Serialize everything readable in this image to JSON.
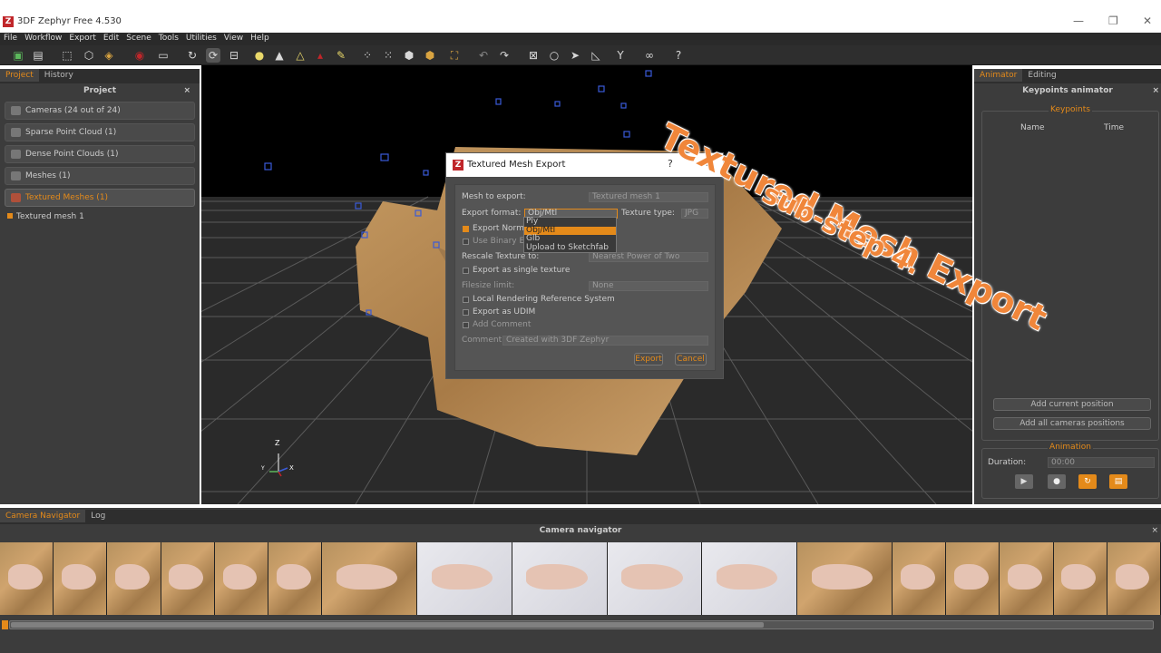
{
  "window": {
    "title": "3DF Zephyr Free 4.530",
    "logo": "Z",
    "minimize": "—",
    "maximize": "❐",
    "close": "✕"
  },
  "menu": [
    "File",
    "Workflow",
    "Export",
    "Edit",
    "Scene",
    "Tools",
    "Utilities",
    "View",
    "Help"
  ],
  "left_panel": {
    "tabs": [
      "Project",
      "History"
    ],
    "title": "Project",
    "close": "×",
    "items": [
      {
        "label": "Cameras (24 out of 24)",
        "icon": "camera-icon"
      },
      {
        "label": "Sparse Point Cloud (1)",
        "icon": "sparse-cloud-icon"
      },
      {
        "label": "Dense Point Clouds (1)",
        "icon": "dense-cloud-icon"
      },
      {
        "label": "Meshes (1)",
        "icon": "mesh-icon"
      },
      {
        "label": "Textured Meshes (1)",
        "icon": "textured-mesh-icon"
      }
    ],
    "tree_item": "Textured mesh 1"
  },
  "right_panel": {
    "tabs": [
      "Animator",
      "Editing"
    ],
    "title": "Keypoints animator",
    "close": "×",
    "keypoints_legend": "Keypoints",
    "columns": [
      "Name",
      "Time"
    ],
    "add_current": "Add current position",
    "add_all": "Add all cameras positions",
    "animation_legend": "Animation",
    "duration_label": "Duration:",
    "duration_value": "00:00"
  },
  "viewport": {
    "axis_z": "Z",
    "axis_y": "Y",
    "axis_x": "X"
  },
  "dialog": {
    "title": "Textured Mesh Export",
    "help": "?",
    "close": "✕",
    "mesh_label": "Mesh to export:",
    "mesh_value": "Textured mesh 1",
    "format_label": "Export format:",
    "format_value": "Obj/Mtl",
    "texture_type_label": "Texture type:",
    "texture_type_value": "JPG",
    "export_normals": "Export Normals",
    "use_binary": "Use Binary Encoding",
    "rescale_label": "Rescale Texture to:",
    "rescale_value": "Nearest Power of Two",
    "single_texture": "Export as single texture",
    "filesize_label": "Filesize limit:",
    "filesize_value": "None",
    "local_ref": "Local Rendering Reference System",
    "udim": "Export as UDIM",
    "add_comment": "Add Comment",
    "comment_label": "Comment",
    "comment_value": "Created with 3DF Zephyr",
    "export_btn": "Export",
    "cancel_btn": "Cancel",
    "dropdown_options": [
      "Ply",
      "Obj/Mtl",
      "Glb",
      "Upload to Sketchfab"
    ],
    "dropdown_selected": "Obj/Mtl"
  },
  "bottom_panel": {
    "tabs": [
      "Camera Navigator",
      "Log"
    ],
    "title": "Camera navigator",
    "close": "×"
  },
  "overlay": {
    "line1": "Textured Mesh Export",
    "line2": "sub-step 4.",
    "color": "#f0863a"
  },
  "colors": {
    "accent": "#e48a1a",
    "panel": "#3c3c3c",
    "viewport": "#1e1e1e"
  }
}
